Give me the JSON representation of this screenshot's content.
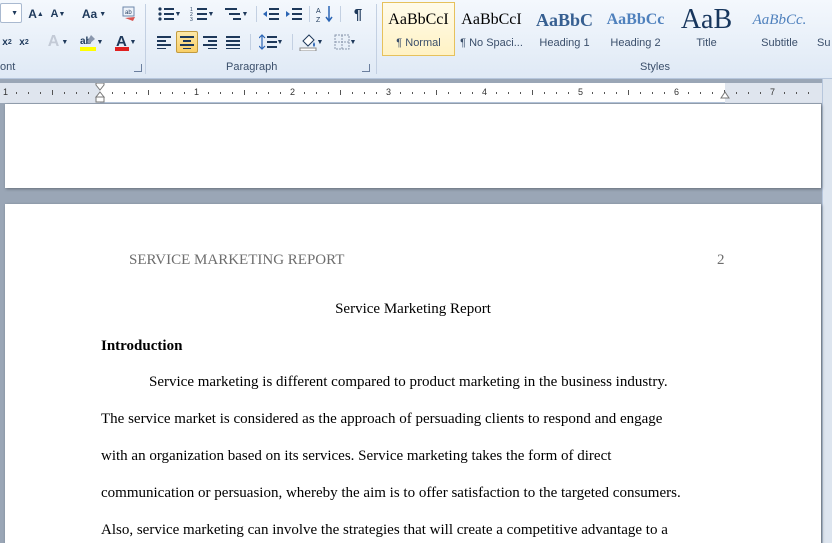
{
  "ribbon": {
    "font_group_label": "ont",
    "paragraph_group_label": "Paragraph",
    "styles_group_label": "Styles",
    "change_case_label": "Aa",
    "styles": [
      {
        "sample": "AaBbCcI",
        "name": "¶ Normal"
      },
      {
        "sample": "AaBbCcI",
        "name": "¶ No Spaci..."
      },
      {
        "sample": "AaBbC",
        "name": "Heading 1"
      },
      {
        "sample": "AaBbCc",
        "name": "Heading 2"
      },
      {
        "sample": "AaB",
        "name": "Title"
      },
      {
        "sample": "AaBbCc.",
        "name": "Subtitle"
      },
      {
        "sample": "",
        "name": "Su"
      }
    ]
  },
  "ruler": {
    "numbers": [
      "1",
      "1",
      "2",
      "3",
      "4",
      "5",
      "6",
      "7"
    ]
  },
  "document": {
    "header_title": "SERVICE MARKETING REPORT",
    "page_number": "2",
    "title": "Service Marketing Report",
    "section_heading": "Introduction",
    "lines": [
      "Service marketing is different compared to product marketing in the business industry.",
      "The service market is considered as the approach of persuading clients to respond and engage",
      "with an organization based on its services. Service marketing takes the form of direct",
      "communication or persuasion, whereby the aim is to offer satisfaction to the targeted consumers.",
      "Also, service marketing can involve the strategies that will create a competitive advantage to a"
    ]
  }
}
